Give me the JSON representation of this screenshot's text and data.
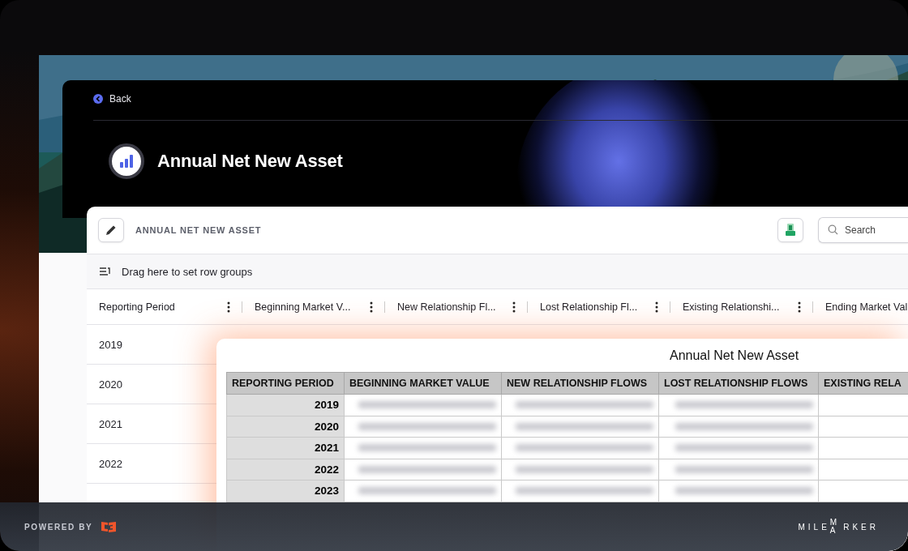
{
  "page": {
    "back": "Back",
    "title": "Annual Net New Asset"
  },
  "grid": {
    "title": "ANNUAL NET NEW ASSET",
    "search": {
      "placeholder": "Search"
    },
    "group_hint": "Drag here to set row groups",
    "columns": [
      "Reporting Period",
      "Beginning Market V...",
      "New Relationship Fl...",
      "Lost Relationship Fl...",
      "Existing Relationshi...",
      "Ending Market Val"
    ],
    "rows": [
      "2019",
      "2020",
      "2021",
      "2022"
    ]
  },
  "spreadsheet": {
    "title": "Annual Net New Asset",
    "columns": [
      "REPORTING PERIOD",
      "BEGINNING MARKET VALUE",
      "NEW RELATIONSHIP FLOWS",
      "LOST RELATIONSHIP FLOWS",
      "EXISTING RELA"
    ],
    "rows": [
      "2019",
      "2020",
      "2021",
      "2022",
      "2023"
    ]
  },
  "footer": {
    "powered_by": "POWERED BY",
    "brand": {
      "left": "MILE",
      "top": "M",
      "bottom": "A",
      "right": "RKER"
    }
  }
}
